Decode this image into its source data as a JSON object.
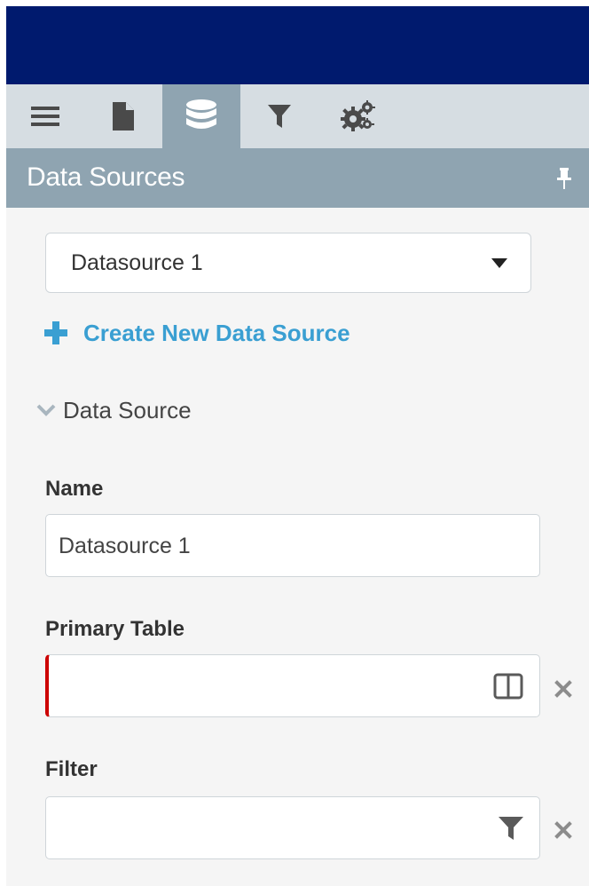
{
  "colors": {
    "top_bar": "#001a6e",
    "tab_bar": "#d6dde2",
    "active_tab": "#8fa4b1",
    "section_header": "#8fa4b1",
    "link": "#3a9fd2",
    "invalid": "#cc0000",
    "panel_bg": "#f5f5f5"
  },
  "tabs": [
    {
      "icon": "hamburger-menu-icon",
      "active": false
    },
    {
      "icon": "document-icon",
      "active": false
    },
    {
      "icon": "database-icon",
      "active": true
    },
    {
      "icon": "filter-icon",
      "active": false
    },
    {
      "icon": "gears-icon",
      "active": false
    }
  ],
  "panel": {
    "title": "Data Sources",
    "pin_icon": "pin-icon"
  },
  "datasource_select": {
    "selected": "Datasource 1"
  },
  "create_link": {
    "label": "Create New Data Source",
    "icon": "plus-icon"
  },
  "section": {
    "label": "Data Source",
    "expanded": true
  },
  "form": {
    "name": {
      "label": "Name",
      "value": "Datasource 1"
    },
    "primary_table": {
      "label": "Primary Table",
      "value": "",
      "icon": "table-columns-icon"
    },
    "filter": {
      "label": "Filter",
      "value": "",
      "icon": "filter-icon"
    }
  }
}
